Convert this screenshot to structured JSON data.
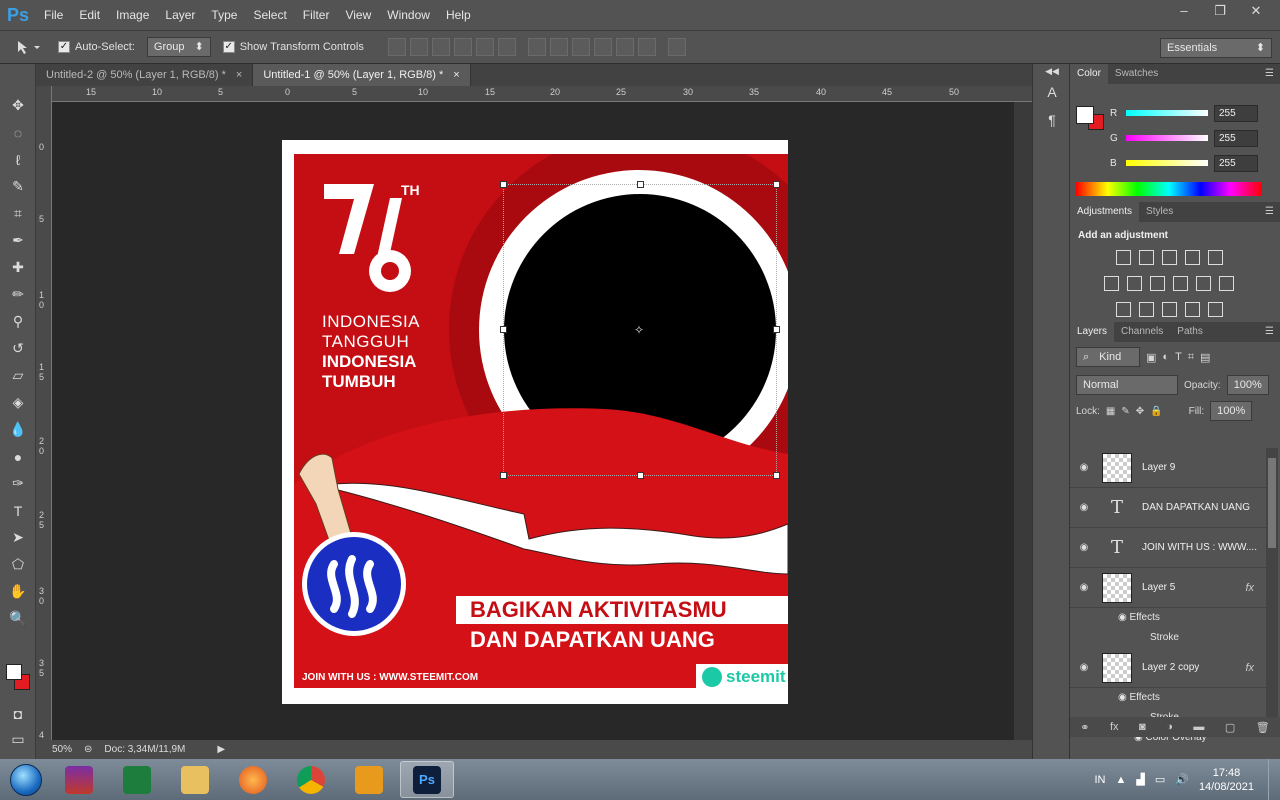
{
  "app": {
    "logo": "Ps"
  },
  "menu": [
    "File",
    "Edit",
    "Image",
    "Layer",
    "Type",
    "Select",
    "Filter",
    "View",
    "Window",
    "Help"
  ],
  "window_controls": {
    "minimize": "–",
    "maximize": "❐",
    "close": "✕"
  },
  "options": {
    "auto_select_label": "Auto-Select:",
    "auto_select_value": "Group",
    "transform_label": "Show Transform Controls",
    "workspace": "Essentials"
  },
  "tabs": [
    {
      "label": "Untitled-2 @ 50% (Layer 1, RGB/8) *",
      "close": "×"
    },
    {
      "label": "Untitled-1 @ 50% (Layer 1, RGB/8) *",
      "close": "×"
    }
  ],
  "ruler_top": [
    "15",
    "10",
    "5",
    "0",
    "5",
    "10",
    "15",
    "20",
    "25",
    "30",
    "35",
    "40",
    "45",
    "50"
  ],
  "ruler_left": [
    "0",
    "5",
    "1 0",
    "1 5",
    "2 0",
    "2 5",
    "3 0",
    "3 5",
    "4"
  ],
  "artwork": {
    "anniv_number": "76",
    "anniv_suffix": "TH",
    "line1": "INDONESIA",
    "line2": "TANGGUH",
    "line3": "INDONESIA",
    "line4": "TUMBUH",
    "cta1": "BAGIKAN AKTIVITASMU",
    "cta2": "DAN DAPATKAN UANG",
    "join": "JOIN WITH US : WWW.STEEMIT.COM",
    "brand": "steemit",
    "colors": {
      "red": "#c40e13",
      "dark_red": "#a90a0f",
      "blue": "#1a2fc2",
      "teal": "#1cc9a6"
    }
  },
  "status": {
    "zoom": "50%",
    "doc": "Doc: 3,34M/11,9M"
  },
  "color_panel": {
    "tabs": [
      "Color",
      "Swatches"
    ],
    "channels": [
      {
        "name": "R",
        "value": "255"
      },
      {
        "name": "G",
        "value": "255"
      },
      {
        "name": "B",
        "value": "255"
      }
    ]
  },
  "adjustments": {
    "tabs": [
      "Adjustments",
      "Styles"
    ],
    "title": "Add an adjustment"
  },
  "layers_panel": {
    "tabs": [
      "Layers",
      "Channels",
      "Paths"
    ],
    "kind": "Kind",
    "blend": "Normal",
    "opacity_label": "Opacity:",
    "opacity": "100%",
    "lock_label": "Lock:",
    "fill_label": "Fill:",
    "fill": "100%",
    "layers": [
      {
        "name": "Layer 9",
        "type": "raster"
      },
      {
        "name": "DAN DAPATKAN UANG",
        "type": "text"
      },
      {
        "name": "JOIN WITH US : WWW....",
        "type": "text"
      },
      {
        "name": "Layer 5",
        "type": "raster",
        "fx": "fx"
      },
      {
        "name": "Layer 2 copy",
        "type": "raster",
        "fx": "fx"
      }
    ],
    "sub_items": {
      "effects": "Effects",
      "stroke": "Stroke",
      "color_overlay": "Color Overlay"
    }
  },
  "taskbar": {
    "lang": "IN",
    "time": "17:48",
    "date": "14/08/2021",
    "apps": [
      "winrar",
      "excel",
      "explorer",
      "firefox",
      "chrome",
      "outlook",
      "photoshop"
    ]
  }
}
